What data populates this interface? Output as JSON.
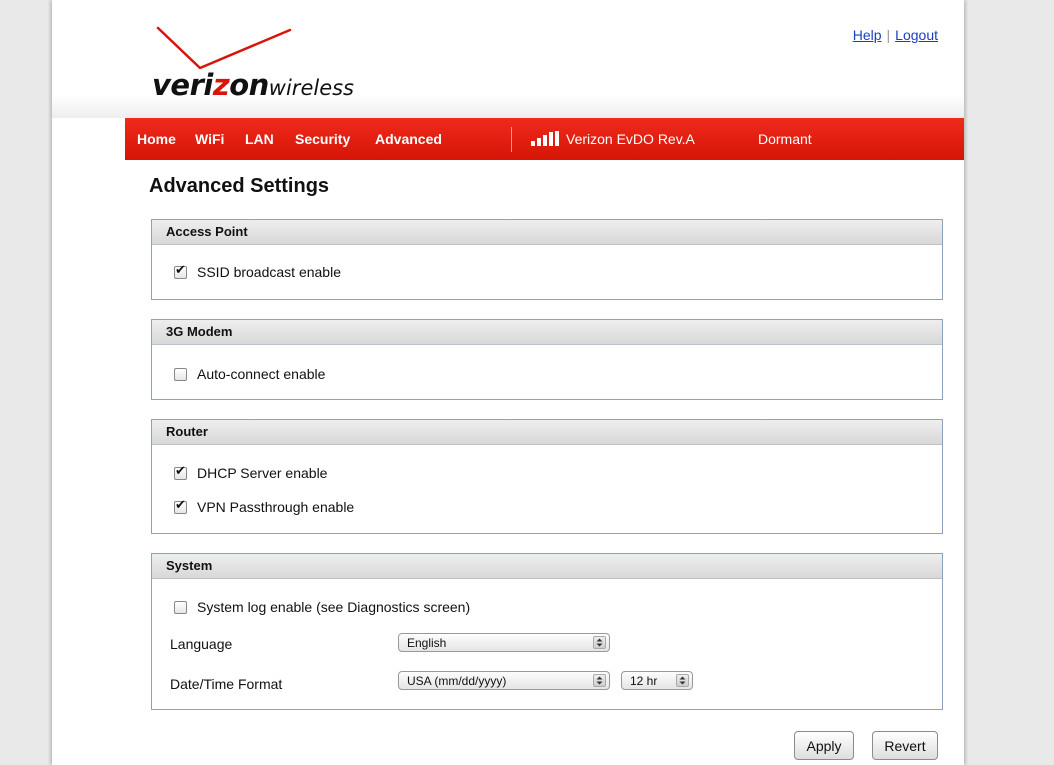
{
  "header": {
    "logo": {
      "word_bold": "veri",
      "word_z": "z",
      "word_on": "on",
      "word_light": "wireless"
    },
    "links": {
      "help": "Help",
      "separator": "|",
      "logout": "Logout"
    }
  },
  "nav": {
    "items": [
      "Home",
      "WiFi",
      "LAN",
      "Security",
      "Advanced"
    ],
    "carrier": "Verizon  EvDO Rev.A",
    "connection_status": "Dormant",
    "signal_icon": "signal-bars-icon",
    "battery_icon": "battery-icon"
  },
  "page": {
    "title": "Advanced Settings"
  },
  "sections": {
    "access_point": {
      "title": "Access Point",
      "ssid_broadcast": {
        "label": "SSID broadcast enable",
        "checked": true
      }
    },
    "modem": {
      "title": "3G Modem",
      "auto_connect": {
        "label": "Auto-connect enable",
        "checked": false
      }
    },
    "router": {
      "title": "Router",
      "dhcp": {
        "label": "DHCP Server enable",
        "checked": true
      },
      "vpn": {
        "label": "VPN Passthrough enable",
        "checked": true
      }
    },
    "system": {
      "title": "System",
      "system_log": {
        "label": "System log enable (see Diagnostics screen)",
        "checked": false
      },
      "language": {
        "label": "Language",
        "value": "English"
      },
      "datetime": {
        "label": "Date/Time Format",
        "date_value": "USA (mm/dd/yyyy)",
        "time_value": "12 hr"
      }
    }
  },
  "actions": {
    "apply": "Apply",
    "revert": "Revert"
  },
  "colors": {
    "nav_red": "#e21f10",
    "link_blue": "#1a3fbf",
    "section_border": "#8ea3b8"
  }
}
